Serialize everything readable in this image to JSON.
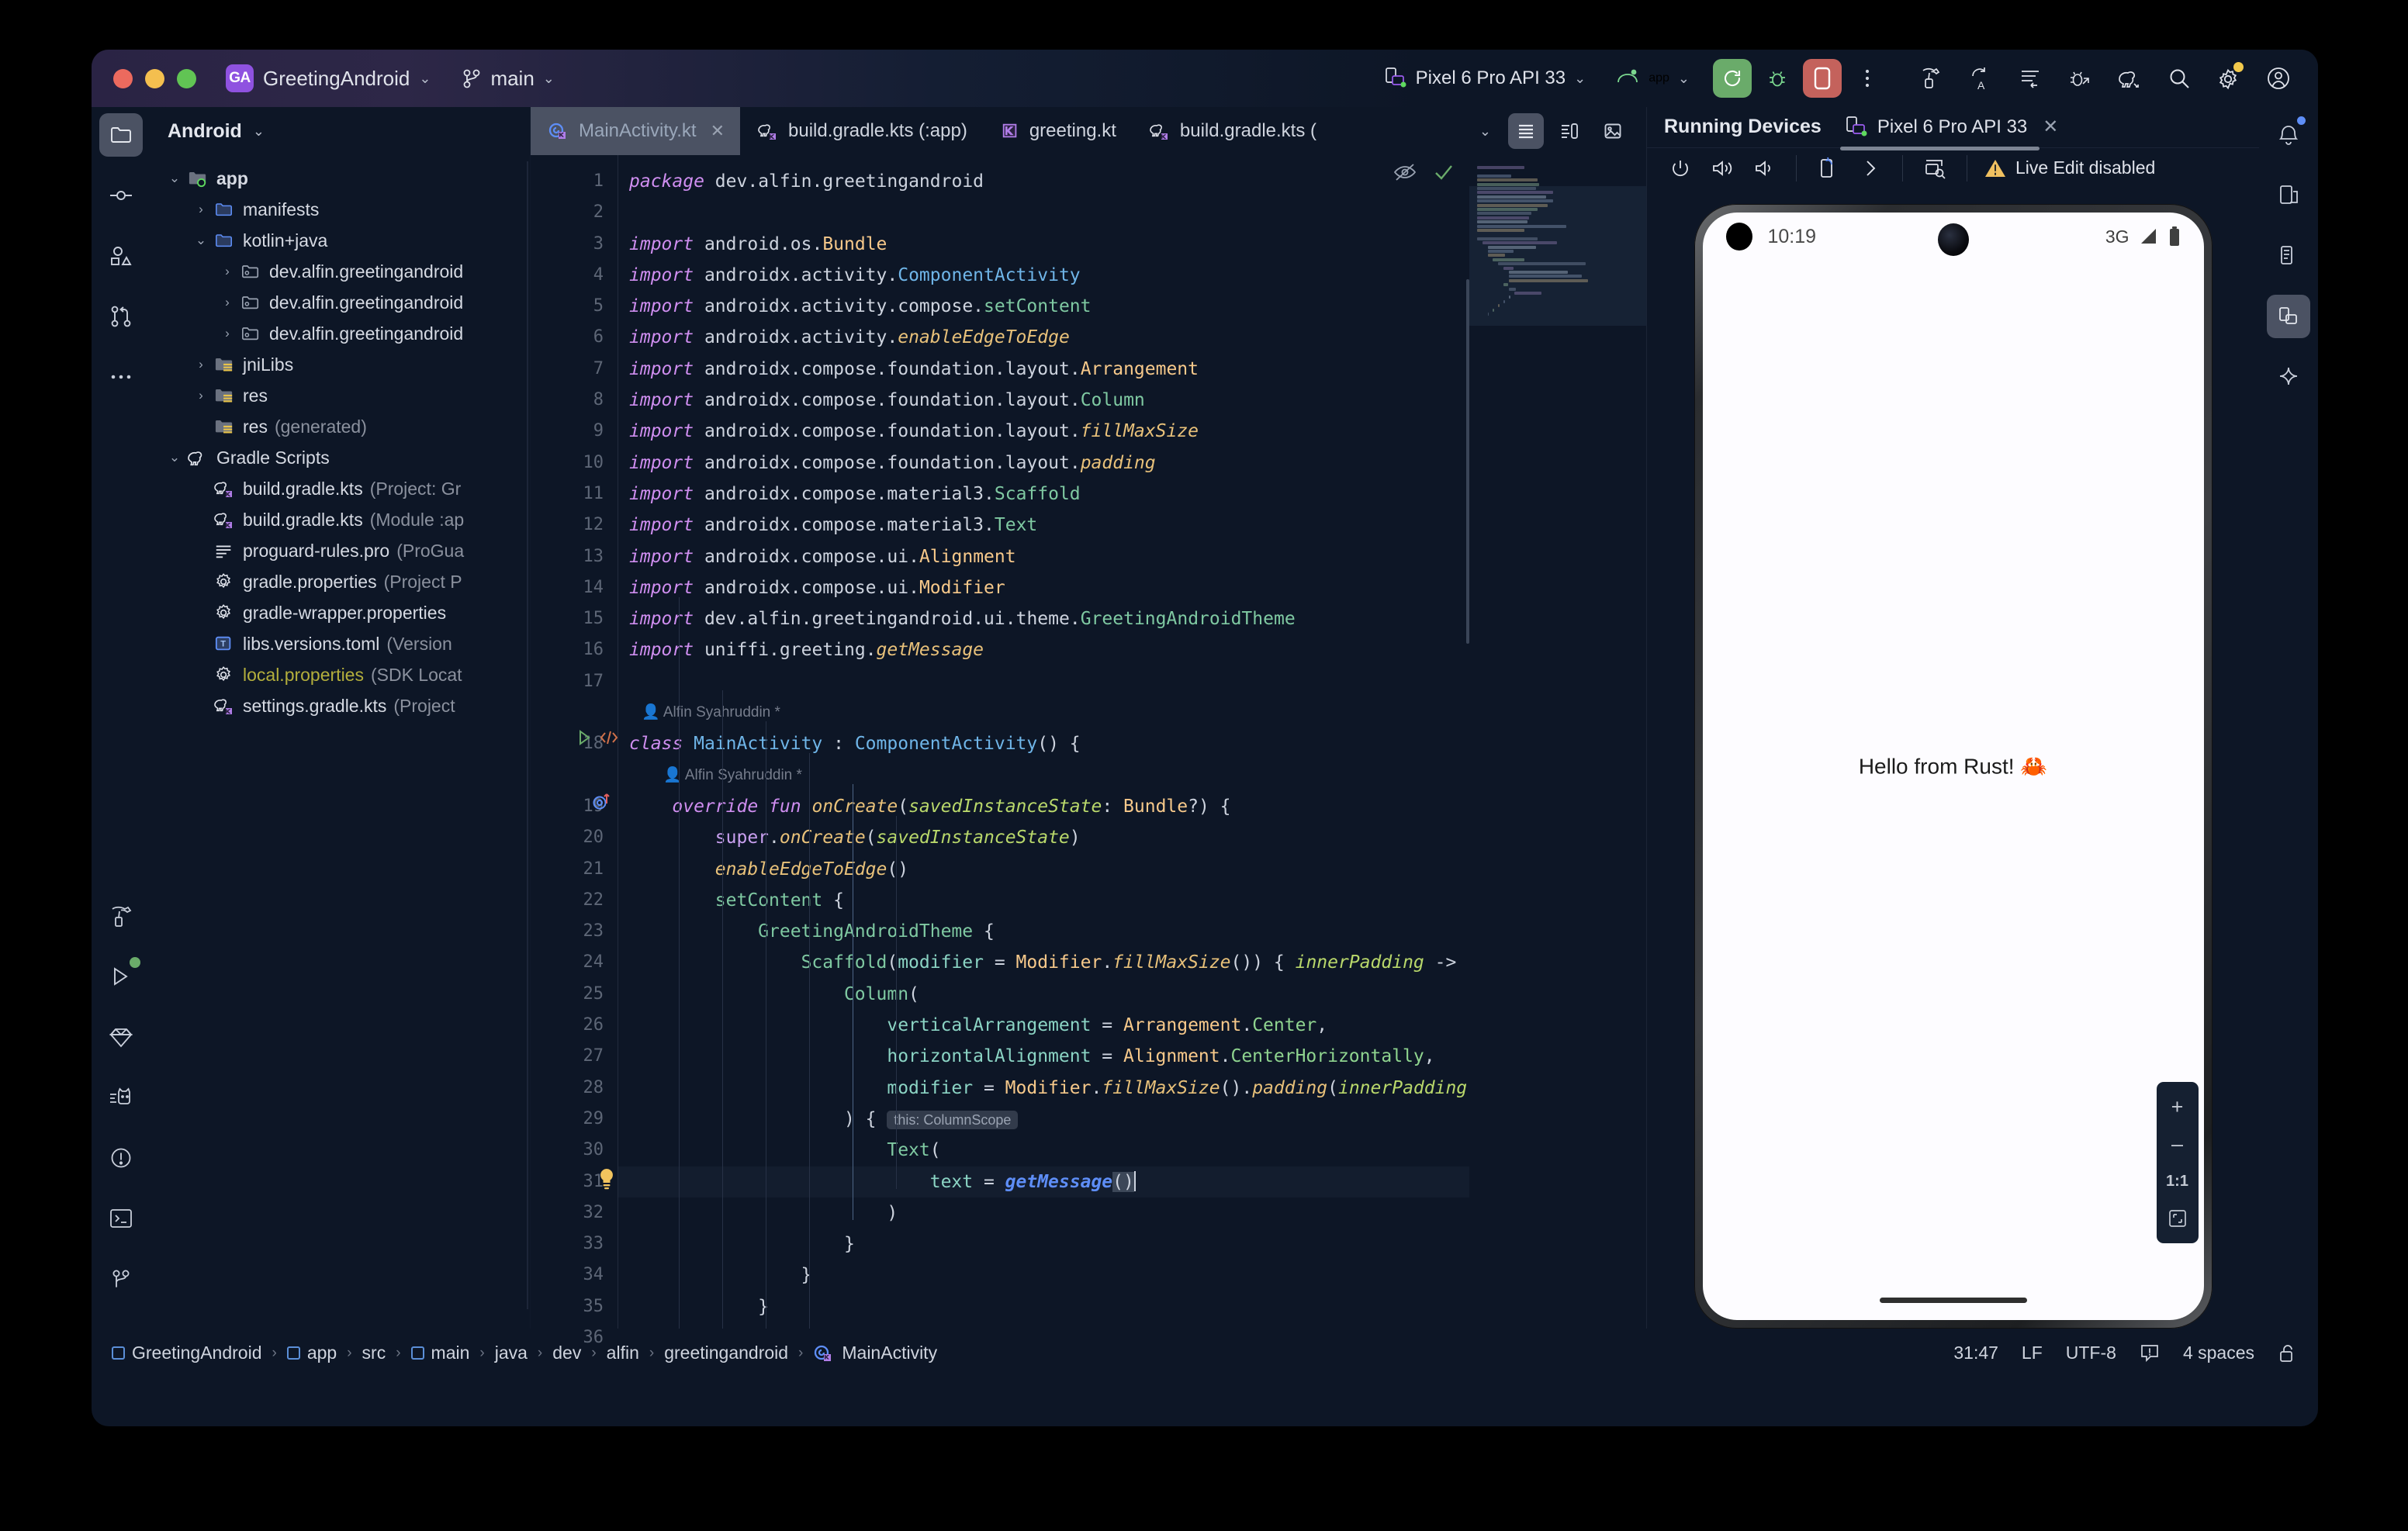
{
  "titlebar": {
    "project_badge": "GA",
    "project_name": "GreetingAndroid",
    "branch": "main",
    "device_selector": "Pixel 6 Pro API 33",
    "run_config": "app",
    "icons": {
      "project_chevron": "chevron-down-icon",
      "branch_icon": "git-branch-icon",
      "branch_chevron": "chevron-down-icon",
      "device_icon": "device-icon",
      "device_chevron": "chevron-down-icon",
      "android_icon": "android-head-icon",
      "module_chevron": "chevron-down-icon",
      "run": "run-icon",
      "debug": "debug-bug-icon",
      "stop": "stop-icon",
      "more": "more-vertical-icon",
      "build": "hammer-icon",
      "sync": "gradle-sync-icon",
      "logcat": "logcat-icon",
      "profiler": "profiler-bug-icon",
      "gradle": "gradle-elephant-icon",
      "search": "search-icon",
      "settings": "gear-icon",
      "account": "account-avatar-icon"
    }
  },
  "left_rail": {
    "items": [
      {
        "name": "project-folder-icon",
        "selected": true
      },
      {
        "name": "commit-icon",
        "selected": false
      },
      {
        "name": "resource-manager-icon",
        "selected": false
      },
      {
        "name": "pull-requests-icon",
        "selected": false
      },
      {
        "name": "more-tool-windows-icon",
        "selected": false
      }
    ],
    "bottom_items": [
      {
        "name": "build-hammer-icon"
      },
      {
        "name": "run-play-icon"
      },
      {
        "name": "app-quality-insights-icon"
      },
      {
        "name": "logcat-cat-icon"
      },
      {
        "name": "problems-icon"
      },
      {
        "name": "terminal-icon"
      },
      {
        "name": "version-control-icon"
      }
    ]
  },
  "project_panel": {
    "title": "Android",
    "title_chevron": "chevron-down-icon",
    "tree": [
      {
        "indent": 0,
        "arrow": "down",
        "icon": "module-folder-icon",
        "label": "app",
        "bold": true,
        "sub": ""
      },
      {
        "indent": 1,
        "arrow": "right",
        "icon": "blue-folder-icon",
        "label": "manifests",
        "bold": false,
        "sub": ""
      },
      {
        "indent": 1,
        "arrow": "down",
        "icon": "blue-folder-icon",
        "label": "kotlin+java",
        "bold": false,
        "sub": ""
      },
      {
        "indent": 2,
        "arrow": "right",
        "icon": "package-folder-icon",
        "label": "dev.alfin.greetingandroid",
        "bold": false,
        "sub": ""
      },
      {
        "indent": 2,
        "arrow": "right",
        "icon": "package-folder-icon",
        "label": "dev.alfin.greetingandroid",
        "bold": false,
        "sub": ""
      },
      {
        "indent": 2,
        "arrow": "right",
        "icon": "package-folder-icon",
        "label": "dev.alfin.greetingandroid",
        "bold": false,
        "sub": ""
      },
      {
        "indent": 1,
        "arrow": "right",
        "icon": "res-folder-icon",
        "label": "jniLibs",
        "bold": false,
        "sub": ""
      },
      {
        "indent": 1,
        "arrow": "right",
        "icon": "res-folder-icon",
        "label": "res",
        "bold": false,
        "sub": ""
      },
      {
        "indent": 1,
        "arrow": "none",
        "icon": "res-folder-icon",
        "label": "res",
        "bold": false,
        "sub": "(generated)"
      },
      {
        "indent": 0,
        "arrow": "down",
        "icon": "gradle-elephant-icon",
        "label": "Gradle Scripts",
        "bold": false,
        "sub": ""
      },
      {
        "indent": 1,
        "arrow": "none",
        "icon": "gradle-kts-icon",
        "label": "build.gradle.kts",
        "bold": false,
        "sub": "(Project: Gr"
      },
      {
        "indent": 1,
        "arrow": "none",
        "icon": "gradle-kts-icon",
        "label": "build.gradle.kts",
        "bold": false,
        "sub": "(Module :ap"
      },
      {
        "indent": 1,
        "arrow": "none",
        "icon": "text-lines-icon",
        "label": "proguard-rules.pro",
        "bold": false,
        "sub": "(ProGua"
      },
      {
        "indent": 1,
        "arrow": "none",
        "icon": "gear-icon",
        "label": "gradle.properties",
        "bold": false,
        "sub": "(Project P"
      },
      {
        "indent": 1,
        "arrow": "none",
        "icon": "gear-icon",
        "label": "gradle-wrapper.properties",
        "bold": false,
        "sub": ""
      },
      {
        "indent": 1,
        "arrow": "none",
        "icon": "toml-icon",
        "label": "libs.versions.toml",
        "bold": false,
        "sub": "(Version"
      },
      {
        "indent": 1,
        "arrow": "none",
        "icon": "gear-icon",
        "label": "local.properties",
        "bold": false,
        "sub": "(SDK Locat",
        "color": "yellow"
      },
      {
        "indent": 1,
        "arrow": "none",
        "icon": "gradle-kts-icon",
        "label": "settings.gradle.kts",
        "bold": false,
        "sub": "(Project"
      }
    ]
  },
  "editor_tabs": {
    "tabs": [
      {
        "label": "MainActivity.kt",
        "icon": "kotlin-class-icon",
        "active": true,
        "closable": true
      },
      {
        "label": "build.gradle.kts (:app)",
        "icon": "gradle-kts-icon",
        "active": false,
        "closable": false
      },
      {
        "label": "greeting.kt",
        "icon": "kotlin-file-icon",
        "active": false,
        "closable": false
      },
      {
        "label": "build.gradle.kts (",
        "icon": "gradle-kts-icon",
        "active": false,
        "closable": false
      }
    ],
    "overflow_chevron": "chevron-down-icon",
    "actions": [
      {
        "name": "code-view-icon",
        "selected": true
      },
      {
        "name": "split-view-icon",
        "selected": false
      },
      {
        "name": "design-view-icon",
        "selected": false
      }
    ]
  },
  "editor": {
    "inspection_icons": {
      "hide_hints": "eye-off-icon",
      "status_ok": "check-icon"
    },
    "annotations": [
      {
        "line": 18,
        "text": "Alfin Syahruddin *"
      },
      {
        "line": 19,
        "text": "Alfin Syahruddin *"
      }
    ],
    "caret_token": "()",
    "inlay_hint": "this: ColumnScope",
    "lines": [
      {
        "n": 1,
        "text": "package dev.alfin.greetingandroid"
      },
      {
        "n": 2,
        "text": ""
      },
      {
        "n": 3,
        "text": "import android.os.Bundle"
      },
      {
        "n": 4,
        "text": "import androidx.activity.ComponentActivity"
      },
      {
        "n": 5,
        "text": "import androidx.activity.compose.setContent"
      },
      {
        "n": 6,
        "text": "import androidx.activity.enableEdgeToEdge"
      },
      {
        "n": 7,
        "text": "import androidx.compose.foundation.layout.Arrangement"
      },
      {
        "n": 8,
        "text": "import androidx.compose.foundation.layout.Column"
      },
      {
        "n": 9,
        "text": "import androidx.compose.foundation.layout.fillMaxSize"
      },
      {
        "n": 10,
        "text": "import androidx.compose.foundation.layout.padding"
      },
      {
        "n": 11,
        "text": "import androidx.compose.material3.Scaffold"
      },
      {
        "n": 12,
        "text": "import androidx.compose.material3.Text"
      },
      {
        "n": 13,
        "text": "import androidx.compose.ui.Alignment"
      },
      {
        "n": 14,
        "text": "import androidx.compose.ui.Modifier"
      },
      {
        "n": 15,
        "text": "import dev.alfin.greetingandroid.ui.theme.GreetingAndroidTheme"
      },
      {
        "n": 16,
        "text": "import uniffi.greeting.getMessage"
      },
      {
        "n": 17,
        "text": ""
      },
      {
        "n": 18,
        "text": "class MainActivity : ComponentActivity() {"
      },
      {
        "n": 19,
        "text": "    override fun onCreate(savedInstanceState: Bundle?) {"
      },
      {
        "n": 20,
        "text": "        super.onCreate(savedInstanceState)"
      },
      {
        "n": 21,
        "text": "        enableEdgeToEdge()"
      },
      {
        "n": 22,
        "text": "        setContent {"
      },
      {
        "n": 23,
        "text": "            GreetingAndroidTheme {"
      },
      {
        "n": 24,
        "text": "                Scaffold(modifier = Modifier.fillMaxSize()) { innerPadding ->"
      },
      {
        "n": 25,
        "text": "                    Column("
      },
      {
        "n": 26,
        "text": "                        verticalArrangement = Arrangement.Center,"
      },
      {
        "n": 27,
        "text": "                        horizontalAlignment = Alignment.CenterHorizontally,"
      },
      {
        "n": 28,
        "text": "                        modifier = Modifier.fillMaxSize().padding(innerPadding)"
      },
      {
        "n": 29,
        "text": "                    ) {"
      },
      {
        "n": 30,
        "text": "                        Text("
      },
      {
        "n": 31,
        "text": "                            text = getMessage()"
      },
      {
        "n": 32,
        "text": "                        )"
      },
      {
        "n": 33,
        "text": "                    }"
      },
      {
        "n": 34,
        "text": "                }"
      },
      {
        "n": 35,
        "text": "            }"
      },
      {
        "n": 36,
        "text": "        }"
      }
    ]
  },
  "devices": {
    "panel_title": "Running Devices",
    "tab_label": "Pixel 6 Pro API 33",
    "tab_icon": "device-icon",
    "tab_close": "close-icon",
    "toolbar": [
      {
        "name": "power-icon"
      },
      {
        "name": "volume-up-icon"
      },
      {
        "name": "volume-down-icon"
      },
      {
        "name": "rotate-icon"
      },
      {
        "name": "chevron-right-icon"
      },
      {
        "name": "screenshot-icon"
      }
    ],
    "live_edit_status": "Live Edit disabled",
    "live_edit_icon": "warning-icon",
    "zoom_controls": [
      {
        "name": "zoom-in-button",
        "label": "+"
      },
      {
        "name": "zoom-out-button",
        "label": "–"
      },
      {
        "name": "zoom-actual-button",
        "label": "1:1"
      },
      {
        "name": "zoom-fit-button",
        "label": "fit-icon"
      }
    ],
    "emulator": {
      "status_time": "10:19",
      "network": "3G",
      "signal_icon": "signal-icon",
      "battery_icon": "battery-icon",
      "app_text": "Hello from Rust! 🦀"
    }
  },
  "right_rail": {
    "items": [
      {
        "name": "notifications-icon",
        "selected": false,
        "badge": true
      },
      {
        "name": "device-manager-icon",
        "selected": false
      },
      {
        "name": "device-file-explorer-icon",
        "selected": false
      },
      {
        "name": "running-devices-icon",
        "selected": true
      },
      {
        "name": "gemini-icon",
        "selected": false
      }
    ]
  },
  "statusbar": {
    "breadcrumbs": [
      {
        "label": "GreetingAndroid",
        "icon": "module-icon"
      },
      {
        "label": "app",
        "icon": "module-icon"
      },
      {
        "label": "src",
        "icon": ""
      },
      {
        "label": "main",
        "icon": "module-icon"
      },
      {
        "label": "java",
        "icon": ""
      },
      {
        "label": "dev",
        "icon": ""
      },
      {
        "label": "alfin",
        "icon": ""
      },
      {
        "label": "greetingandroid",
        "icon": ""
      },
      {
        "label": "MainActivity",
        "icon": "kotlin-class-icon"
      }
    ],
    "separator": "›",
    "caret_position": "31:47",
    "line_separator": "LF",
    "encoding": "UTF-8",
    "inspection_icon": "inspection-icon",
    "indent": "4 spaces",
    "lock_icon": "unlocked-icon"
  },
  "colors": {
    "accent_purple": "#8f52e0",
    "run_green": "#6aab6a",
    "stop_red": "#c4625c",
    "bg": "#0d1626",
    "tab_active": "#4b5263"
  }
}
